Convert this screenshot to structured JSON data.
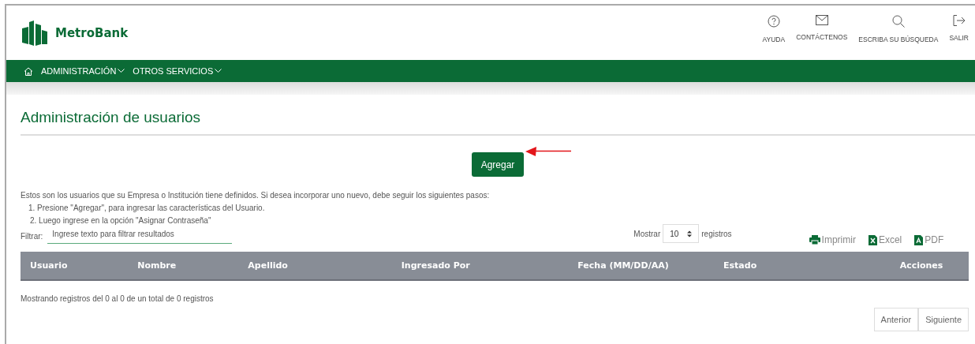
{
  "brand": {
    "name": "MetroBank"
  },
  "top_links": [
    {
      "kind": "help",
      "label": "AYUDA"
    },
    {
      "kind": "mail",
      "label": "CONTÁCTENOS"
    },
    {
      "kind": "search",
      "label": "ESCRIBA SU BÚSQUEDA"
    },
    {
      "kind": "exit",
      "label": "SALIR"
    }
  ],
  "nav": {
    "items": [
      {
        "label": "ADMINISTRACIÓN"
      },
      {
        "label": "OTROS SERVICIOS"
      }
    ]
  },
  "page_title": "Administración de usuarios",
  "add_button": "Agregar",
  "intro": "Estos son los usuarios que su Empresa o Institución tiene definidos. Si desea incorporar uno nuevo, debe seguir los siguientes pasos:",
  "steps": [
    "1. Presione \"Agregar\", para ingresar las características del Usuario.",
    "2. Luego ingrese en la opción \"Asignar Contraseña\""
  ],
  "filter": {
    "label": "Filtrar:",
    "placeholder": "Ingrese texto para filtrar resultados"
  },
  "page_size": {
    "label_before": "Mostrar",
    "value": "10",
    "label_after": "registros"
  },
  "exports": [
    {
      "kind": "print",
      "label": "Imprimir"
    },
    {
      "kind": "excel",
      "label": "Excel"
    },
    {
      "kind": "pdf",
      "label": "PDF"
    }
  ],
  "table": {
    "columns": [
      "Usuario",
      "Nombre",
      "Apellido",
      "Ingresado Por",
      "Fecha (MM/DD/AA)",
      "Estado",
      "Acciones"
    ]
  },
  "summary": "Mostrando registros del 0 al 0 de un total de 0 registros",
  "pagination": [
    "Anterior",
    "Siguiente"
  ]
}
